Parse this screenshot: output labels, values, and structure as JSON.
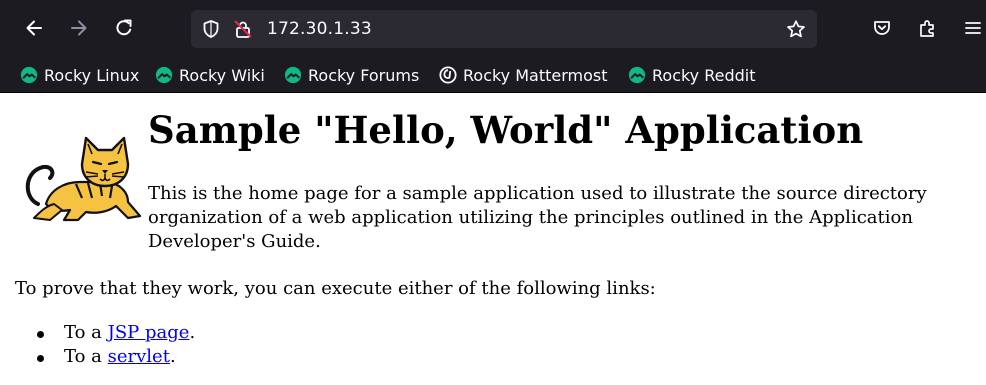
{
  "browser": {
    "url": "172.30.1.33",
    "bookmarks": [
      {
        "label": "Rocky Linux",
        "icon": "rocky-logo-icon"
      },
      {
        "label": "Rocky Wiki",
        "icon": "rocky-logo-icon"
      },
      {
        "label": "Rocky Forums",
        "icon": "rocky-logo-icon"
      },
      {
        "label": "Rocky Mattermost",
        "icon": "mattermost-icon"
      },
      {
        "label": "Rocky Reddit",
        "icon": "rocky-logo-icon"
      }
    ],
    "colors": {
      "chrome": "#1c1b22",
      "urlbar": "#2b2a33",
      "bookmark_icon": "#10b981",
      "icon_fg": "#fbfbfe"
    }
  },
  "page": {
    "title": "Sample \"Hello, World\" Application",
    "intro": "This is the home page for a sample application used to illustrate the source directory organization of a web application utilizing the principles outlined in the Application Developer's Guide.",
    "prove_text": "To prove that they work, you can execute either of the following links:",
    "links": [
      {
        "prefix": "To a ",
        "link_text": "JSP page",
        "suffix": "."
      },
      {
        "prefix": "To a ",
        "link_text": "servlet",
        "suffix": "."
      }
    ],
    "colors": {
      "link": "#0000ee"
    }
  }
}
